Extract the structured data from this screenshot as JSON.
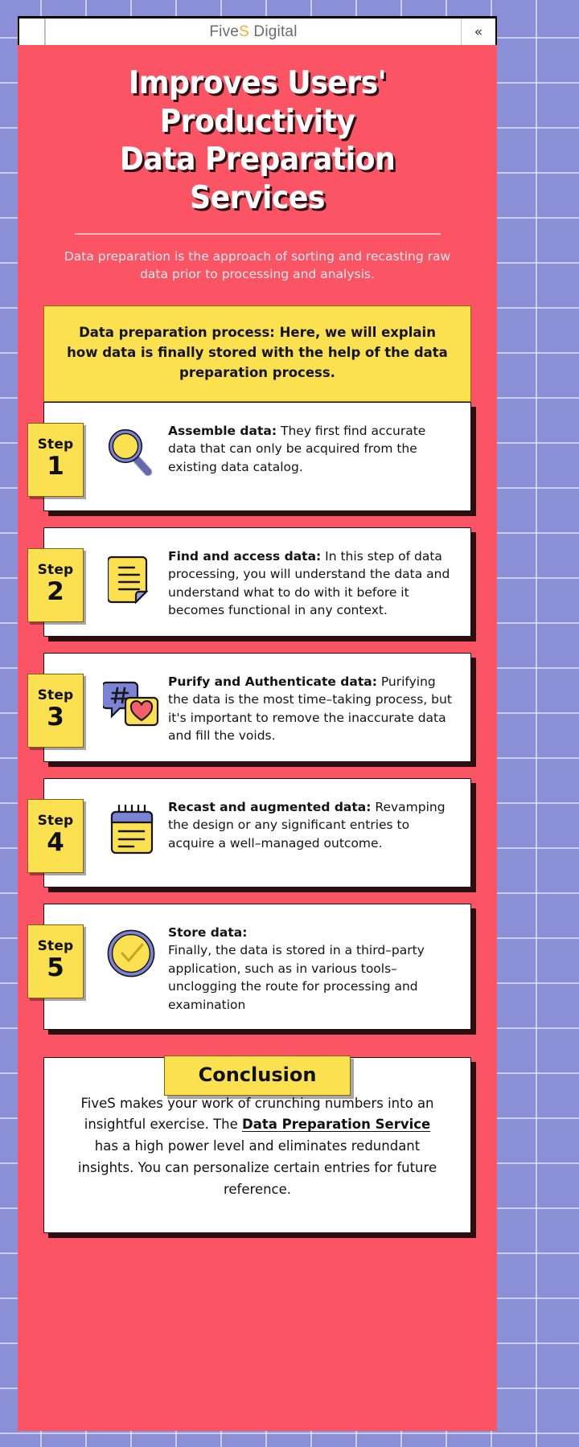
{
  "browser": {
    "brand_prefix": "Five",
    "brand_accent": "S",
    "brand_suffix": " Digital",
    "collapse_label": "«"
  },
  "hero": {
    "title_line1": "Improves Users' Productivity",
    "title_line2": "Data Preparation",
    "title_line3": "Services",
    "subtitle": "Data preparation is the approach of sorting and recasting raw data prior to processing and analysis."
  },
  "intro": {
    "text": "Data preparation process: Here, we will explain how data is finally stored with the help of the data preparation process."
  },
  "steps": [
    {
      "badge_word": "Step",
      "badge_num": "1",
      "icon": "magnifier-icon",
      "heading": "Assemble data:",
      "body": " They first find accurate data that can only be acquired from the existing data catalog."
    },
    {
      "badge_word": "Step",
      "badge_num": "2",
      "icon": "document-icon",
      "heading": "Find and access data:",
      "body": " In this step of data processing, you will understand the data and understand what to do with it before it becomes functional in any context."
    },
    {
      "badge_word": "Step",
      "badge_num": "3",
      "icon": "chat-bubbles-icon",
      "heading": "Purify and Authenticate data:",
      "body": " Purifying the data is the most time–taking process, but it's important to remove the inaccurate data and fill the voids."
    },
    {
      "badge_word": "Step",
      "badge_num": "4",
      "icon": "notepad-icon",
      "heading": "Recast and augmented data:",
      "body": " Revamping the design or any significant entries to acquire a well–managed outcome."
    },
    {
      "badge_word": "Step",
      "badge_num": "5",
      "icon": "check-circle-icon",
      "heading": "Store data:",
      "body": " Finally, the data is stored in a third–party application, such as in various tools– unclogging the route for processing and examination"
    }
  ],
  "conclusion": {
    "tab_label": "Conclusion",
    "part1": "FiveS makes your work of crunching numbers into an insightful exercise. The ",
    "link": "Data Preparation Service",
    "part2": " has a high power level and eliminates redundant insights. You can personalize certain entries for future reference."
  },
  "colors": {
    "poster_red": "#fb5464",
    "accent_yellow": "#fbe14f",
    "icon_blue": "#7b83d4",
    "heart_red": "#f4606a",
    "wallpaper": "#8b8fd6"
  }
}
